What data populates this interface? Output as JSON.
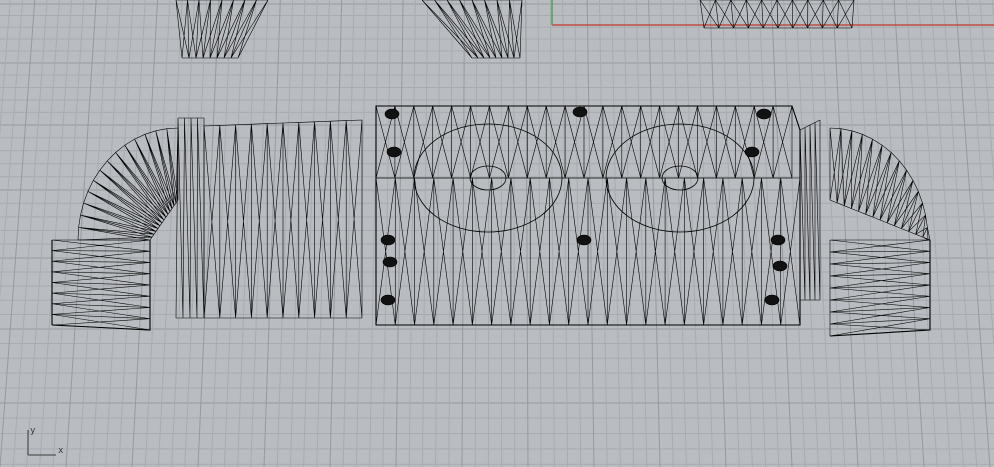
{
  "viewport": {
    "type": "wireframe-3d-view",
    "background": "#b9bcc0",
    "grid_minor_color": "#a8abb0",
    "grid_major_color": "#969a9f",
    "wire_color": "#000000",
    "x_axis_color": "#c0392b",
    "y_axis_color": "#2e9e3b"
  },
  "axes_widget": {
    "x_label": "x",
    "y_label": "y"
  },
  "objects": [
    {
      "name": "wireframe-model",
      "description_icon": "mesh-icon"
    }
  ]
}
